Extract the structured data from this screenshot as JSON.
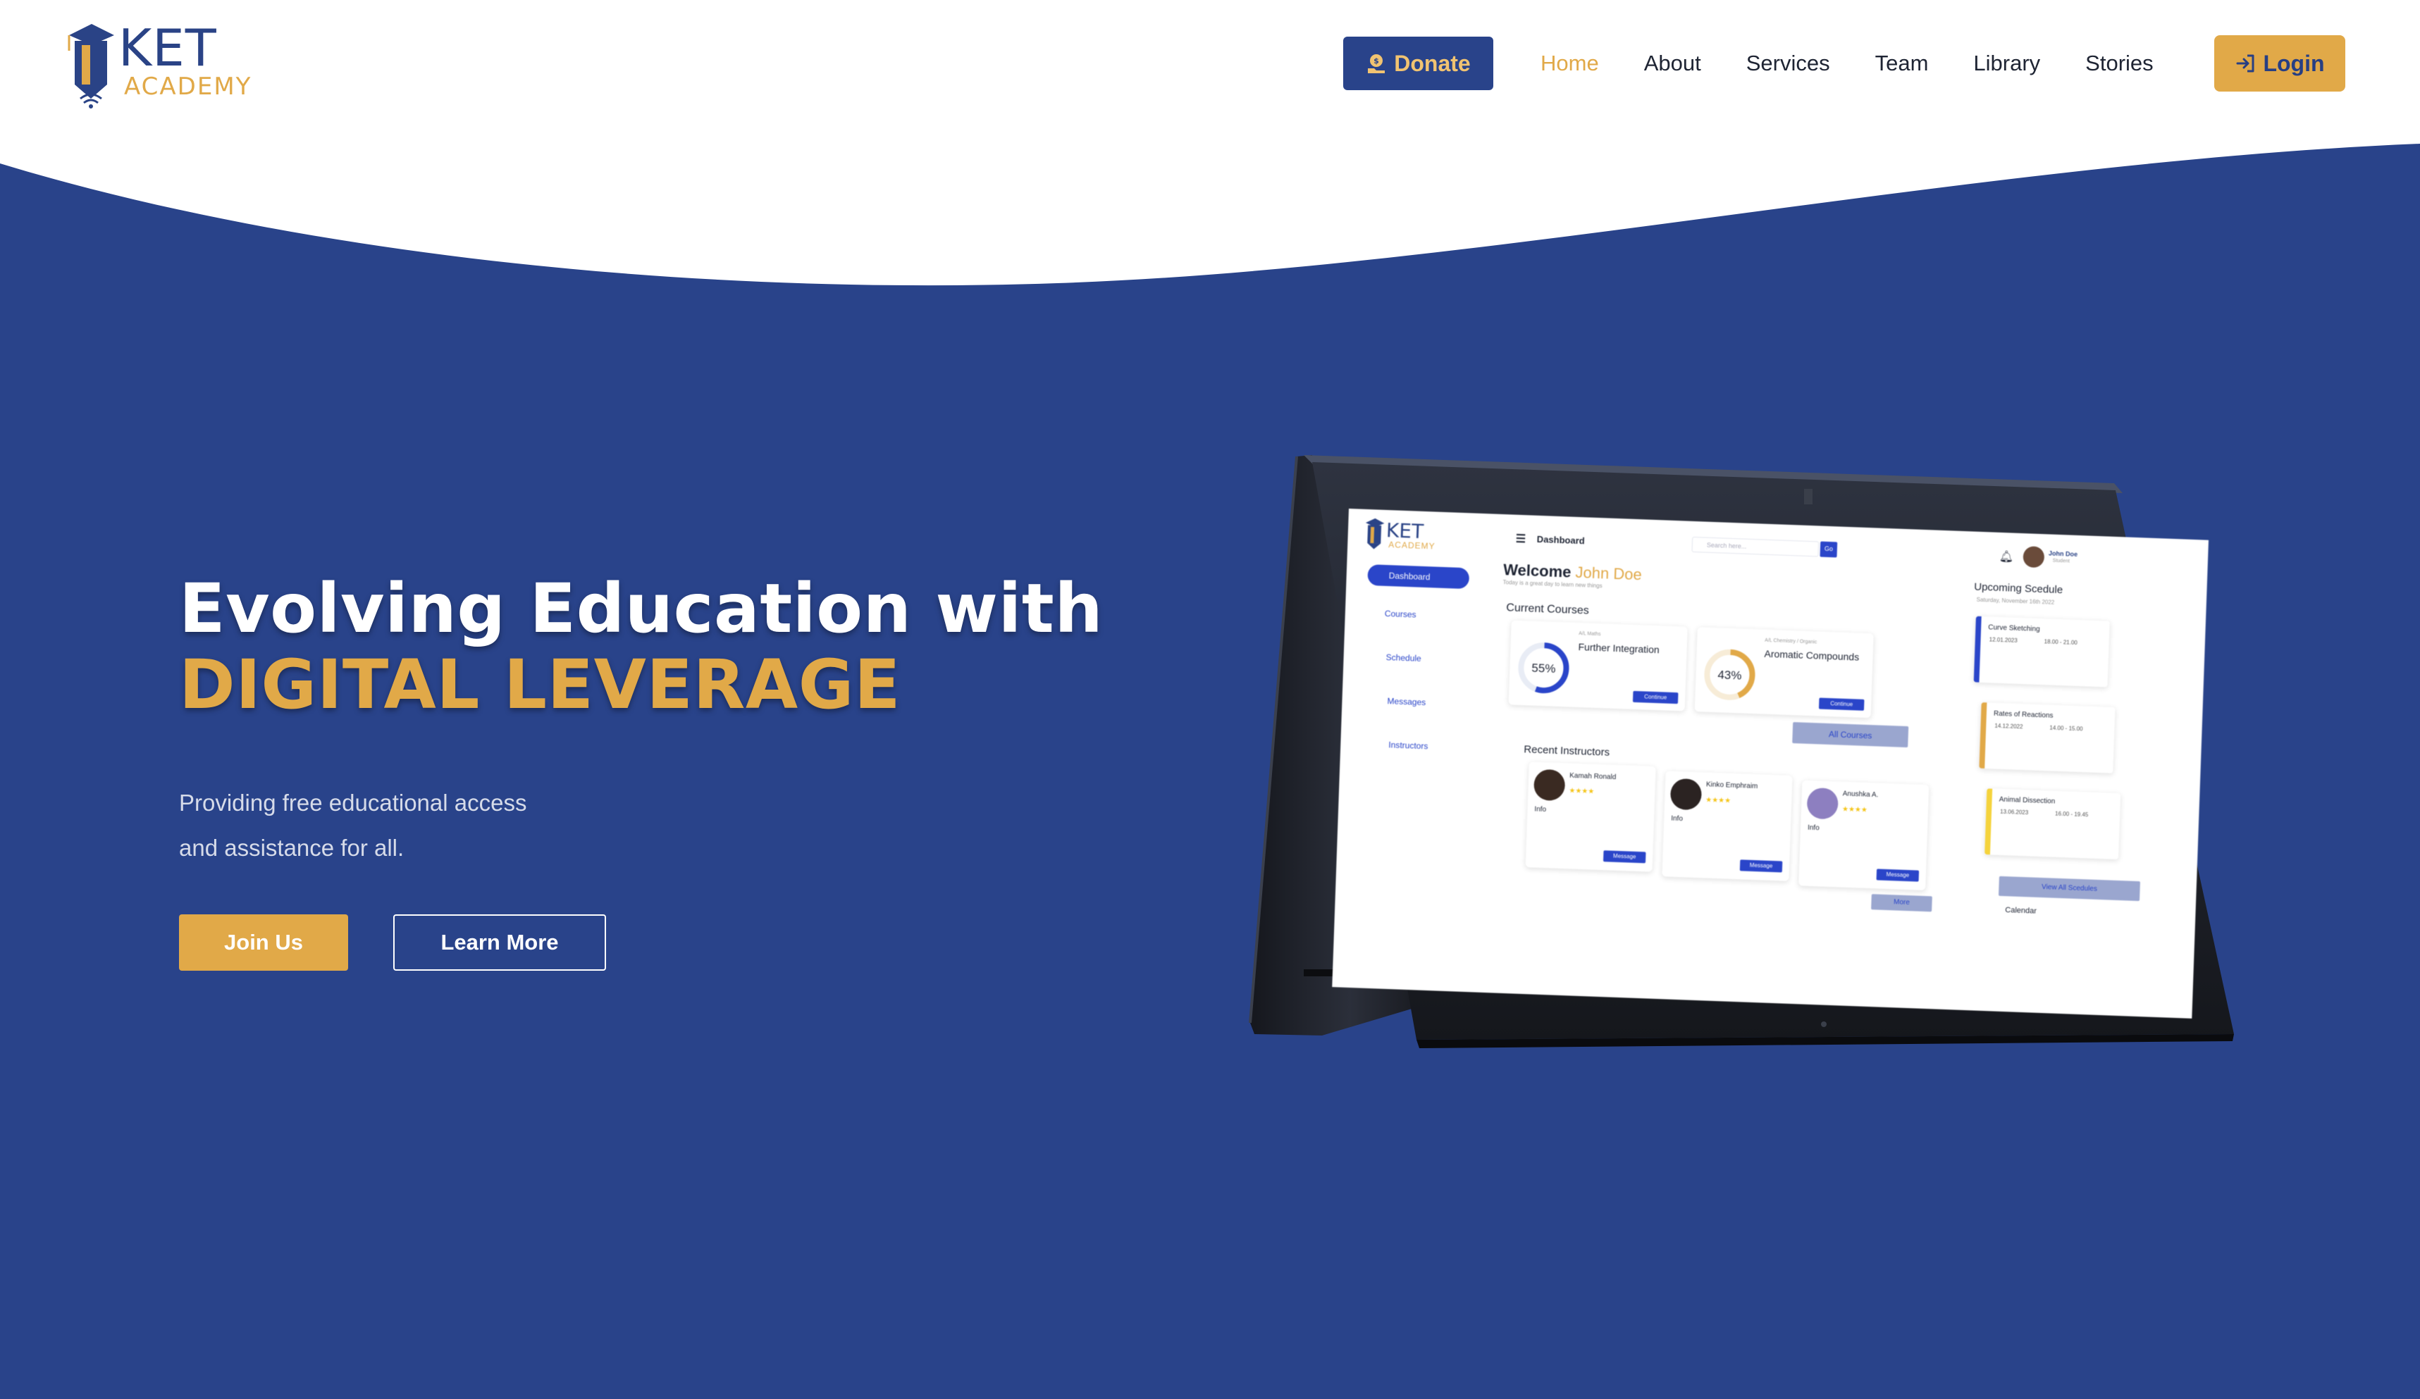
{
  "brand": {
    "name_main": "KET",
    "name_sub": "ACADEMY",
    "primary": "#29438a",
    "accent": "#e1a948",
    "hero_bg": "#29438a"
  },
  "header": {
    "donate_label": "Donate",
    "donate_icon": "donate-coin-icon",
    "nav": [
      {
        "label": "Home",
        "active": true
      },
      {
        "label": "About",
        "active": false
      },
      {
        "label": "Services",
        "active": false
      },
      {
        "label": "Team",
        "active": false
      },
      {
        "label": "Library",
        "active": false
      },
      {
        "label": "Stories",
        "active": false
      }
    ],
    "login_label": "Login",
    "login_icon": "login-arrow-icon"
  },
  "hero": {
    "title_line1": "Evolving Education with",
    "title_line2": "DIGITAL LEVERAGE",
    "subtitle_line1": "Providing free educational access",
    "subtitle_line2": "and assistance for all.",
    "primary_button": "Join Us",
    "secondary_button": "Learn More"
  },
  "dashboard_preview": {
    "logo_main": "KET",
    "logo_sub": "ACADEMY",
    "top_title": "Dashboard",
    "search_placeholder": "Search here...",
    "search_button": "Go",
    "user_name": "John Doe",
    "user_role": "Student",
    "sidebar": [
      "Dashboard",
      "Courses",
      "Schedule",
      "Messages",
      "Instructors"
    ],
    "welcome_prefix": "Welcome",
    "welcome_name": "John Doe",
    "welcome_tagline": "Today is a great day to learn new things",
    "current_courses_label": "Current Courses",
    "courses": [
      {
        "category": "A/L Maths",
        "title": "Further Integration",
        "progress_label": "55%",
        "progress": 55,
        "button": "Continue"
      },
      {
        "category": "A/L Chemistry / Organic",
        "title": "Aromatic Compounds",
        "progress_label": "43%",
        "progress": 43,
        "button": "Continue"
      }
    ],
    "all_courses_button": "All Courses",
    "recent_instructors_label": "Recent Instructors",
    "instructors": [
      {
        "name": "Kamah Ronald",
        "info": "Info",
        "button": "Message"
      },
      {
        "name": "Kinko Emphraim",
        "info": "Info",
        "button": "Message"
      },
      {
        "name": "Anushka A.",
        "info": "Info",
        "button": "Message"
      }
    ],
    "more_button": "More",
    "schedule_label": "Upcoming Scedule",
    "schedule_date": "Saturday, November 16th 2022",
    "schedule": [
      {
        "title": "Curve Sketching",
        "date": "12.01.2023",
        "time": "18.00 - 21.00",
        "color": "#2a45c9"
      },
      {
        "title": "Rates of Reactions",
        "date": "14.12.2022",
        "time": "14.00 - 15.00",
        "color": "#e1a948"
      },
      {
        "title": "Animal Dissection",
        "date": "13.06.2023",
        "time": "16.00 - 19.45",
        "color": "#f5d33c"
      }
    ],
    "view_all_button": "View All Scedules",
    "calendar_label": "Calendar"
  }
}
